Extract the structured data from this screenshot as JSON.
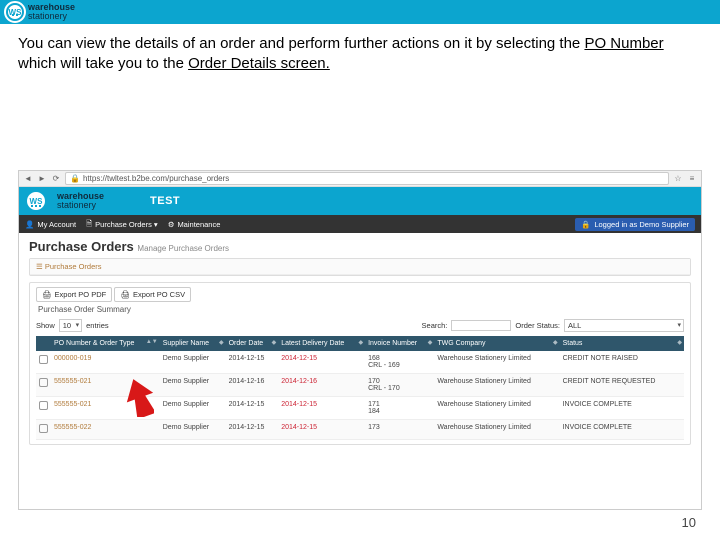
{
  "slide": {
    "brand1": "warehouse",
    "brand2": "stationery",
    "ws": "WS",
    "caption_a": "You can view the details of an order and perform further actions on it by selecting the ",
    "caption_b": "PO Number",
    "caption_c": " which will take you to the ",
    "caption_d": "Order Details screen.",
    "page_no": "10"
  },
  "browser": {
    "url": "https://twltest.b2be.com/purchase_orders"
  },
  "app": {
    "brand1": "warehouse",
    "brand2": "stationery",
    "test": "TEST",
    "nav": {
      "account": "My Account",
      "purchase_orders": "Purchase Orders ▾",
      "maintenance": "Maintenance",
      "logged_in": "Logged in as Demo Supplier"
    },
    "title": "Purchase Orders",
    "subtitle": "Manage Purchase Orders",
    "panel_header": "Purchase Orders",
    "export_pdf": "Export PO PDF",
    "export_csv": "Export PO CSV",
    "summary_title": "Purchase Order Summary",
    "filters": {
      "show_label": "Show",
      "show_value": "10",
      "entries": "entries",
      "search_label": "Search:",
      "status_label": "Order Status:",
      "status_value": "ALL"
    },
    "columns": [
      "",
      "PO Number & Order Type",
      "Supplier Name",
      "Order Date",
      "Latest Delivery Date",
      "Invoice Number",
      "TWG Company",
      "Status"
    ],
    "rows": [
      {
        "po": "000000-019",
        "supplier": "Demo Supplier",
        "order_date": "2014-12-15",
        "deliv": "2014-12-15",
        "inv": "168\nCRL - 169",
        "twg": "Warehouse Stationery Limited",
        "status": "CREDIT NOTE RAISED"
      },
      {
        "po": "555555-021",
        "supplier": "Demo Supplier",
        "order_date": "2014-12-16",
        "deliv": "2014-12-16",
        "inv": "170\nCRL - 170",
        "twg": "Warehouse Stationery Limited",
        "status": "CREDIT NOTE REQUESTED"
      },
      {
        "po": "555555-021",
        "supplier": "Demo Supplier",
        "order_date": "2014-12-15",
        "deliv": "2014-12-15",
        "inv": "171\n184",
        "twg": "Warehouse Stationery Limited",
        "status": "INVOICE COMPLETE"
      },
      {
        "po": "555555-022",
        "supplier": "Demo Supplier",
        "order_date": "2014-12-15",
        "deliv": "2014-12-15",
        "inv": "173",
        "twg": "Warehouse Stationery Limited",
        "status": "INVOICE COMPLETE"
      }
    ]
  }
}
